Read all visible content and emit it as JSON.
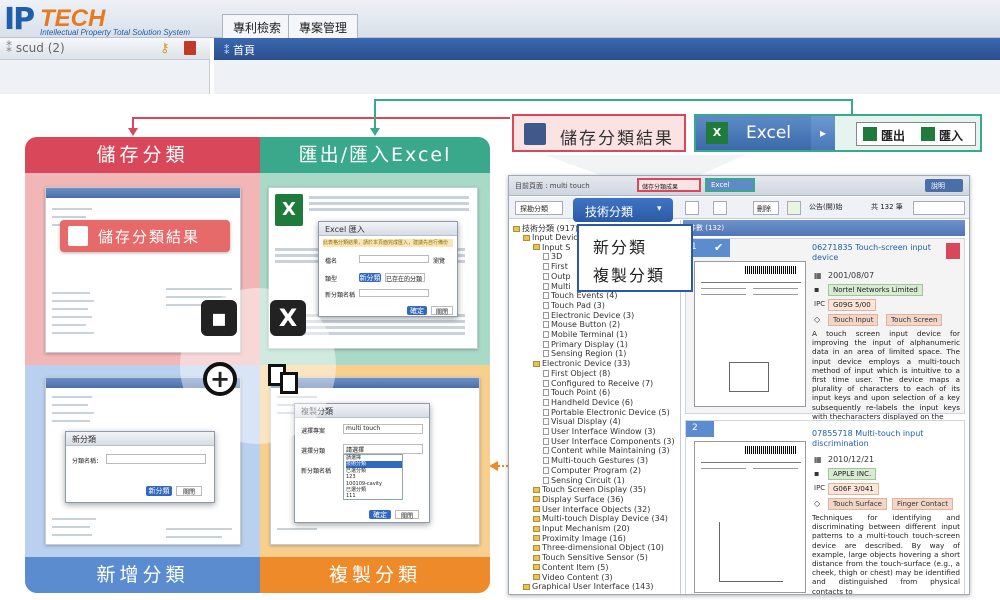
{
  "header": {
    "logo_ip": "IP",
    "logo_tech": "TECH",
    "logo_sub": "Intellectual Property Total Solution System",
    "tabs": [
      {
        "label": "專利檢索"
      },
      {
        "label": "專案管理"
      }
    ]
  },
  "leftpanel": {
    "title": "scud (2)"
  },
  "mainpanel": {
    "title": "首頁"
  },
  "quadrants": {
    "save": {
      "label": "儲存分類",
      "overlay": "儲存分類結果",
      "color": "#d9475a"
    },
    "export": {
      "label": "匯出/匯入Excel",
      "color": "#3aa88a"
    },
    "add": {
      "label": "新增分類",
      "color": "#5b8ccf"
    },
    "copy": {
      "label": "複製分類",
      "color": "#ef8a2a"
    }
  },
  "add_dialog": {
    "title": "新分類",
    "field": "分類名稱：",
    "ok": "新分類",
    "cancel": "關閉"
  },
  "copy_dialog": {
    "title": "複製分類",
    "row1": "選擇專案",
    "row1_val": "multi touch",
    "row2": "選擇分類",
    "row3": "新分類名稱",
    "ok": "確定",
    "cancel": "關閉",
    "options": [
      "請選擇",
      "技術分類",
      "已選分類",
      "123",
      "100109-cavity",
      "已選分類",
      "111"
    ]
  },
  "excel_dialog": {
    "title": "Excel 匯入",
    "note": "此表格分類結果，請於本頁面完成匯入，建議先自行備份",
    "row1": "檔名",
    "row2": "類型",
    "row3": "新分類名稱",
    "browse": "瀏覽",
    "opt1": "新分類",
    "opt2": "已存在的分類",
    "ok": "確定",
    "cancel": "關閉"
  },
  "callouts": {
    "save_result": "儲存分類結果",
    "excel": "Excel",
    "export": "匯出",
    "import": "匯入"
  },
  "rshot": {
    "breadcrumb": "目前頁面 : multi touch",
    "save_btn": "儲存分類成果",
    "excel_btn": "Excel",
    "help": "說明",
    "search_btn": "探勘分類",
    "tech_btn": "技術分類",
    "delete": "刪除",
    "announce": "公告(開)始",
    "total": "共 132 筆",
    "tree_root": "技術分類 (917)",
    "results_label": "件數 (132)",
    "menu": [
      "新分類",
      "複製分類"
    ],
    "tree": [
      {
        "label": "Input Device",
        "level": 1,
        "folder": true
      },
      {
        "label": "Input S",
        "level": 2,
        "folder": true
      },
      {
        "label": "3D",
        "level": 3
      },
      {
        "label": "First",
        "level": 3
      },
      {
        "label": "Outp",
        "level": 3
      },
      {
        "label": "Multi",
        "level": 3
      },
      {
        "label": "Touch Events (4)",
        "level": 3
      },
      {
        "label": "Touch Pad (3)",
        "level": 3
      },
      {
        "label": "Electronic Device (3)",
        "level": 3
      },
      {
        "label": "Mouse Button (2)",
        "level": 3
      },
      {
        "label": "Mobile Terminal (1)",
        "level": 3
      },
      {
        "label": "Primary Display (1)",
        "level": 3
      },
      {
        "label": "Sensing Region (1)",
        "level": 3
      },
      {
        "label": "Electronic Device (33)",
        "level": 2,
        "folder": true
      },
      {
        "label": "First Object (8)",
        "level": 3
      },
      {
        "label": "Configured to Receive (7)",
        "level": 3
      },
      {
        "label": "Touch Point (6)",
        "level": 3
      },
      {
        "label": "Handheld Device (6)",
        "level": 3
      },
      {
        "label": "Portable Electronic Device (5)",
        "level": 3
      },
      {
        "label": "Visual Display (4)",
        "level": 3
      },
      {
        "label": "User Interface Window (3)",
        "level": 3
      },
      {
        "label": "User Interface Components (3)",
        "level": 3
      },
      {
        "label": "Content while Maintaining (3)",
        "level": 3
      },
      {
        "label": "Multi-touch Gestures (3)",
        "level": 3
      },
      {
        "label": "Computer Program (2)",
        "level": 3
      },
      {
        "label": "Sensing Circuit (1)",
        "level": 3
      },
      {
        "label": "Touch Screen Display (35)",
        "level": 2,
        "folder": true
      },
      {
        "label": "Display Surface (36)",
        "level": 2,
        "folder": true
      },
      {
        "label": "User Interface Objects (32)",
        "level": 2,
        "folder": true
      },
      {
        "label": "Multi-touch Display Device (34)",
        "level": 2,
        "folder": true
      },
      {
        "label": "Input Mechanism (20)",
        "level": 2,
        "folder": true
      },
      {
        "label": "Proximity Image (16)",
        "level": 2,
        "folder": true
      },
      {
        "label": "Three-dimensional Object (10)",
        "level": 2,
        "folder": true
      },
      {
        "label": "Touch Sensitive Sensor (5)",
        "level": 2,
        "folder": true
      },
      {
        "label": "Content Item (5)",
        "level": 2,
        "folder": true
      },
      {
        "label": "Video Content (3)",
        "level": 2,
        "folder": true
      },
      {
        "label": "Graphical User Interface (143)",
        "level": 1,
        "folder": true
      }
    ],
    "results": [
      {
        "num": "1",
        "title": "06271835 Touch-screen input device",
        "date": "2001/08/07",
        "assignee": "Nortel Networks Limited",
        "ipc_label": "IPC",
        "ipc": "G09G 5/00",
        "tags": [
          "Touch Input",
          "Touch Screen"
        ],
        "abstract": "A touch screen input device for improving the input of alphanumeric data in an area of limited space. The input device employs a multi-touch method of input which is intuitive to a first time user. The device maps a plurality of characters to each of its input keys and upon selection of a key subsequently re-labels the input keys with thecharacters displayed on the"
      },
      {
        "num": "2",
        "title": "07855718 Multi-touch input discrimination",
        "date": "2010/12/21",
        "assignee": "APPLE INC.",
        "ipc_label": "IPC",
        "ipc": "G06F 3/041",
        "tags": [
          "Touch Surface",
          "Finger Contact"
        ],
        "abstract": "Techniques for identifying and discriminating between different input patterns to a multi-touch touch-screen device are described. By way of example, large objects hovering a short distance from the touch-surface (e.g., a cheek, thigh or chest) may be identified and distinguished from physical contacts to"
      }
    ]
  }
}
